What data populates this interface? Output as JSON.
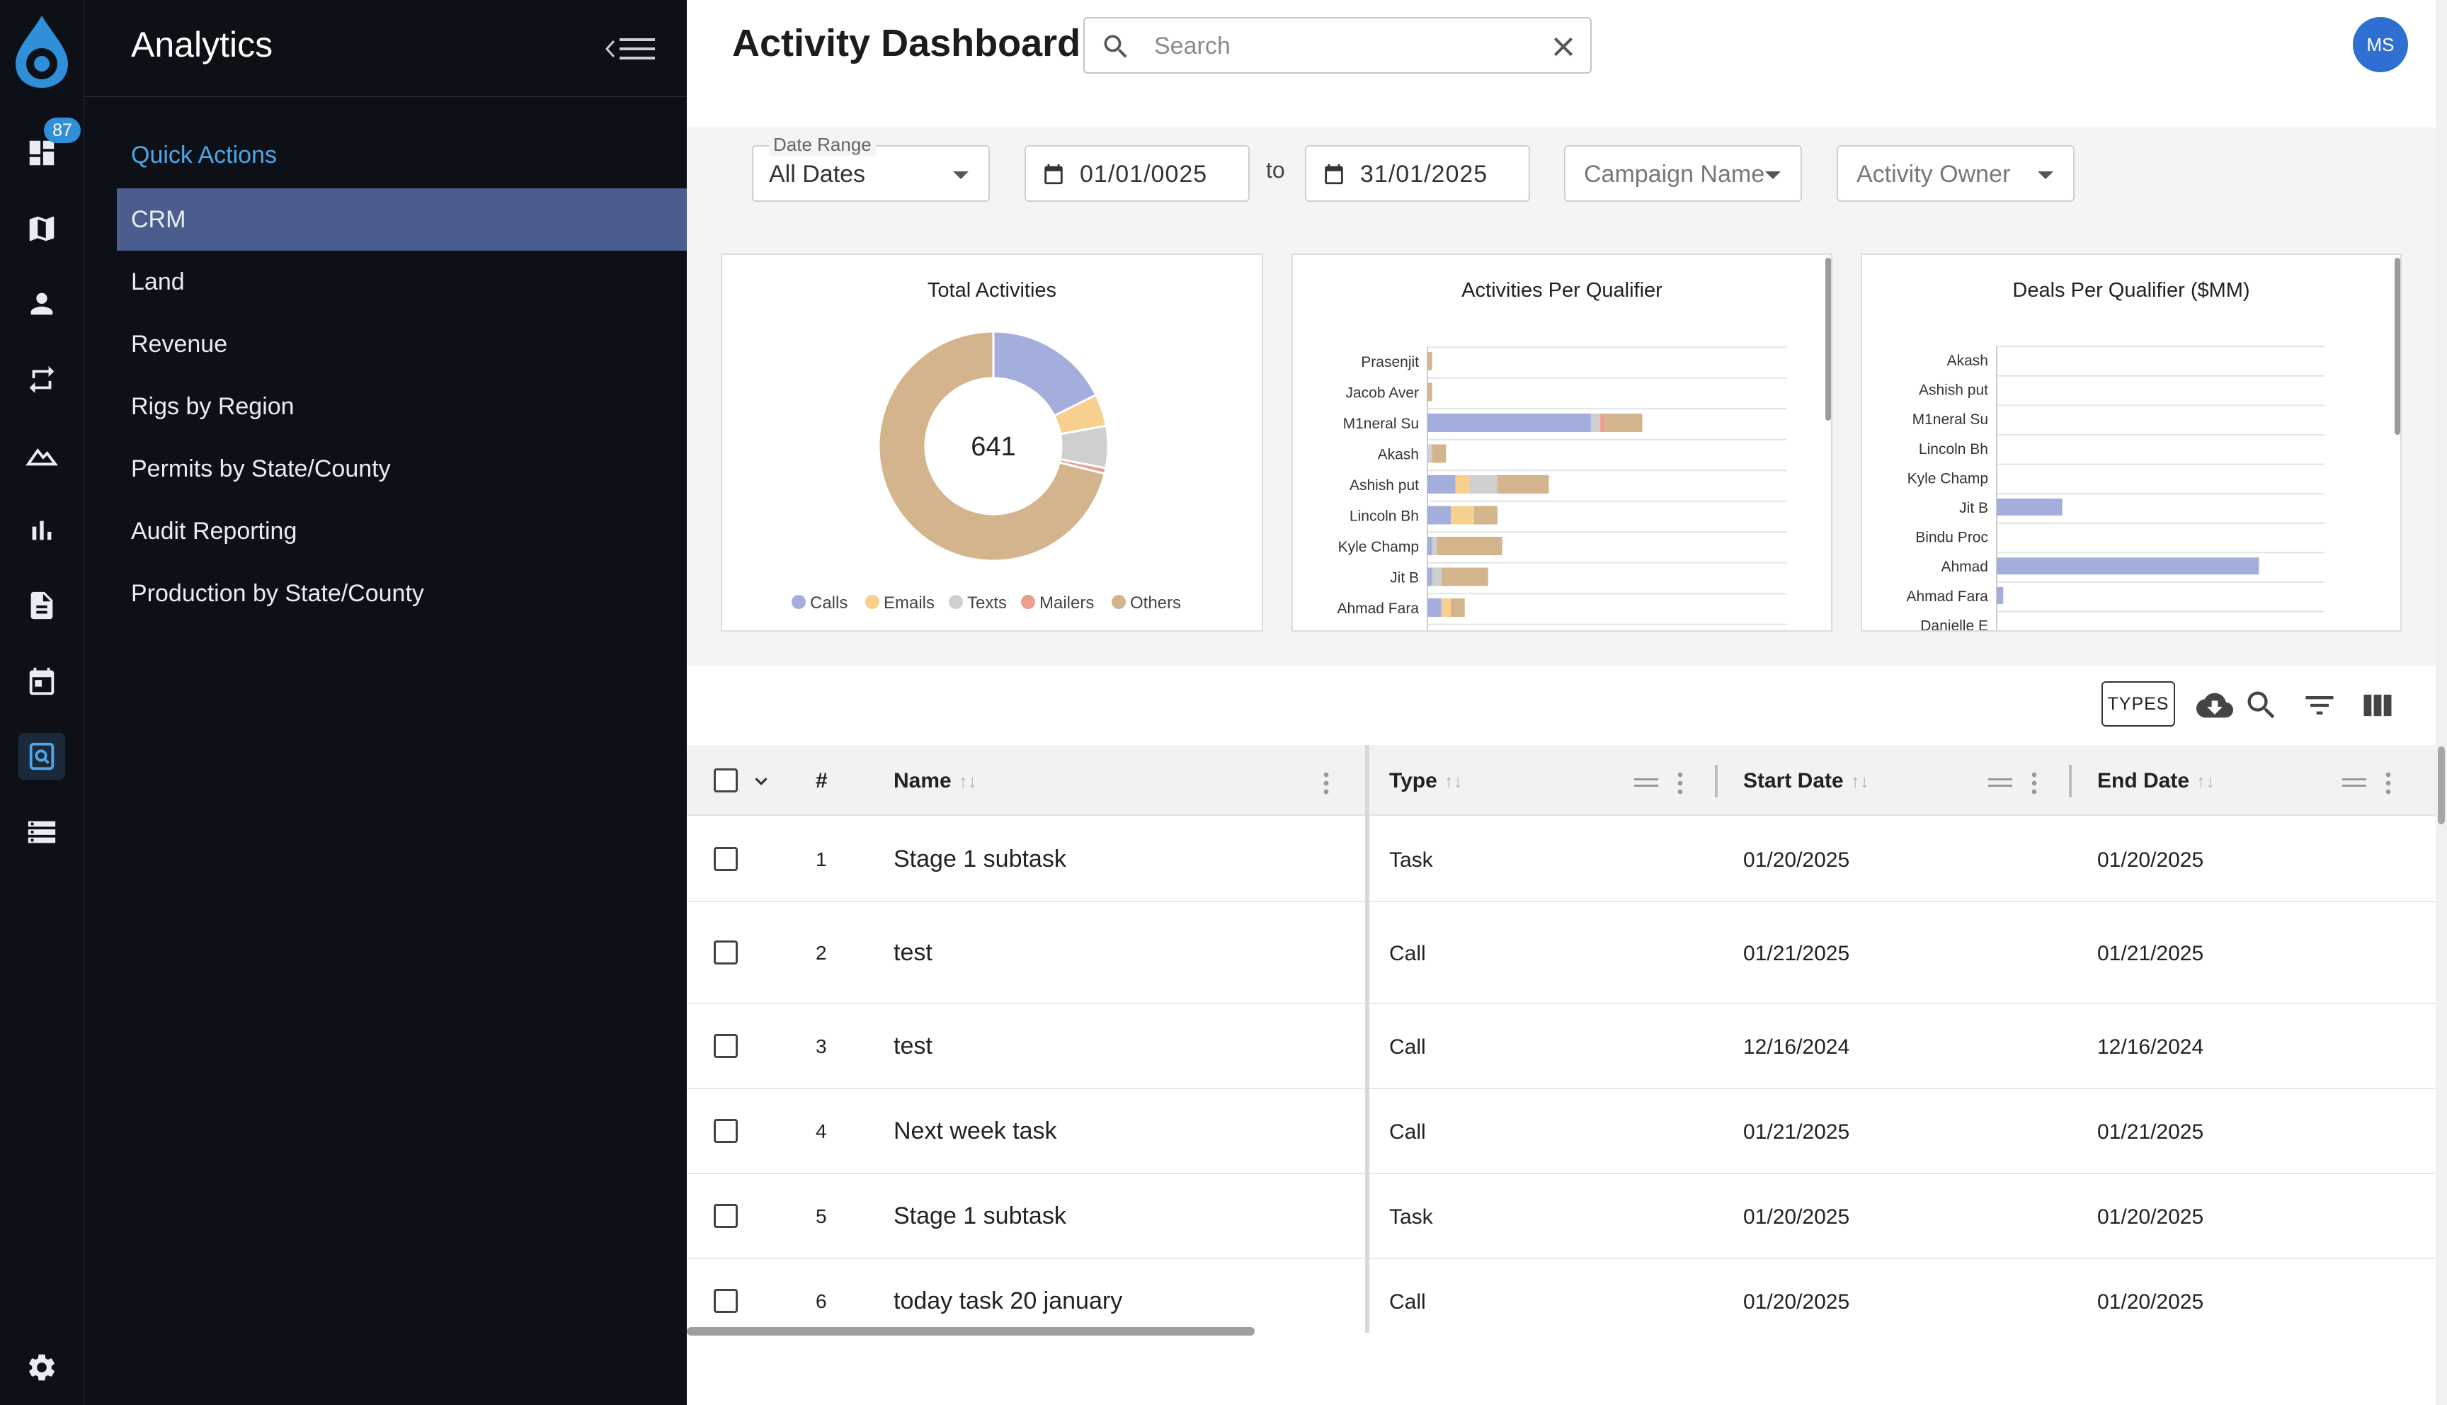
{
  "rail": {
    "badge_count": "87",
    "items": [
      "dashboard-icon",
      "map-icon",
      "person-icon",
      "repeat-icon",
      "terrain-icon",
      "bar-chart-icon",
      "document-icon",
      "calendar-icon",
      "search-document-icon",
      "storage-list-icon"
    ],
    "settings_icon": "gear-icon"
  },
  "menu": {
    "title": "Analytics",
    "quick_actions": "Quick Actions",
    "items": [
      {
        "label": "CRM",
        "active": true
      },
      {
        "label": "Land"
      },
      {
        "label": "Revenue"
      },
      {
        "label": "Rigs by Region"
      },
      {
        "label": "Permits by State/County"
      },
      {
        "label": "Audit Reporting"
      },
      {
        "label": "Production by State/County"
      }
    ]
  },
  "header": {
    "title": "Activity Dashboard",
    "search_placeholder": "Search",
    "avatar": "MS"
  },
  "filters": {
    "date_range_label": "Date Range",
    "date_range_value": "All Dates",
    "start_date": "01/01/0025",
    "to_label": "to",
    "end_date": "31/01/2025",
    "campaign_placeholder": "Campaign Name",
    "owner_placeholder": "Activity Owner"
  },
  "colors": {
    "calls": "#a3aedc",
    "emails": "#f7d08f",
    "texts": "#cfcfcf",
    "mailers": "#e99f8e",
    "others": "#d3b48c",
    "accent": "#4ea6e8",
    "active_menu": "#4a5d8e"
  },
  "chart_data": [
    {
      "type": "pie",
      "title": "Total Activities",
      "center_label": "641",
      "labels": [
        "Calls",
        "Emails",
        "Texts",
        "Mailers",
        "Others"
      ],
      "values": [
        113,
        29,
        38,
        5,
        456
      ]
    },
    {
      "type": "bar",
      "orientation": "horizontal",
      "stacked": true,
      "title": "Activities Per Qualifier",
      "categories": [
        "Prasenjit",
        "Jacob Aver",
        "M1neral Su",
        "Akash",
        "Ashish put",
        "Lincoln Bh",
        "Kyle Champ",
        "Jit B",
        "Ahmad Fara"
      ],
      "series": [
        {
          "name": "Calls",
          "values": [
            0,
            0,
            35,
            0,
            6,
            5,
            1,
            1,
            3
          ]
        },
        {
          "name": "Emails",
          "values": [
            0,
            0,
            0,
            0,
            3,
            5,
            0,
            0,
            2
          ]
        },
        {
          "name": "Texts",
          "values": [
            0,
            0,
            2,
            1,
            6,
            0,
            1,
            2,
            0
          ]
        },
        {
          "name": "Mailers",
          "values": [
            0,
            0,
            1,
            0,
            0,
            0,
            0,
            0,
            0
          ]
        },
        {
          "name": "Others",
          "values": [
            1,
            1,
            8,
            3,
            11,
            5,
            14,
            10,
            3
          ]
        }
      ]
    },
    {
      "type": "bar",
      "orientation": "horizontal",
      "title": "Deals Per Qualifier ($MM)",
      "categories": [
        "Akash",
        "Ashish put",
        "M1neral Su",
        "Lincoln Bh",
        "Kyle Champ",
        "Jit B",
        "Bindu Proc",
        "Ahmad",
        "Ahmad Fara",
        "Danielle E"
      ],
      "series": [
        {
          "name": "Calls",
          "values": [
            0,
            0,
            0,
            0,
            0,
            10,
            0,
            40,
            1,
            0
          ]
        }
      ]
    }
  ],
  "toolbar": {
    "types_label": "TYPES",
    "icons": [
      "cloud-download-icon",
      "search-icon",
      "filter-icon",
      "columns-icon"
    ]
  },
  "table": {
    "columns": [
      "#",
      "Name",
      "Type",
      "Start Date",
      "End Date"
    ],
    "rows": [
      {
        "num": "1",
        "name": "Stage 1 subtask",
        "type": "Task",
        "start": "01/20/2025",
        "end": "01/20/2025"
      },
      {
        "num": "2",
        "name": "test",
        "type": "Call",
        "start": "01/21/2025",
        "end": "01/21/2025"
      },
      {
        "num": "3",
        "name": "test",
        "type": "Call",
        "start": "12/16/2024",
        "end": "12/16/2024"
      },
      {
        "num": "4",
        "name": "Next week task",
        "type": "Call",
        "start": "01/21/2025",
        "end": "01/21/2025"
      },
      {
        "num": "5",
        "name": "Stage 1 subtask",
        "type": "Task",
        "start": "01/20/2025",
        "end": "01/20/2025"
      },
      {
        "num": "6",
        "name": "today task 20 january",
        "type": "Call",
        "start": "01/20/2025",
        "end": "01/20/2025"
      }
    ]
  }
}
